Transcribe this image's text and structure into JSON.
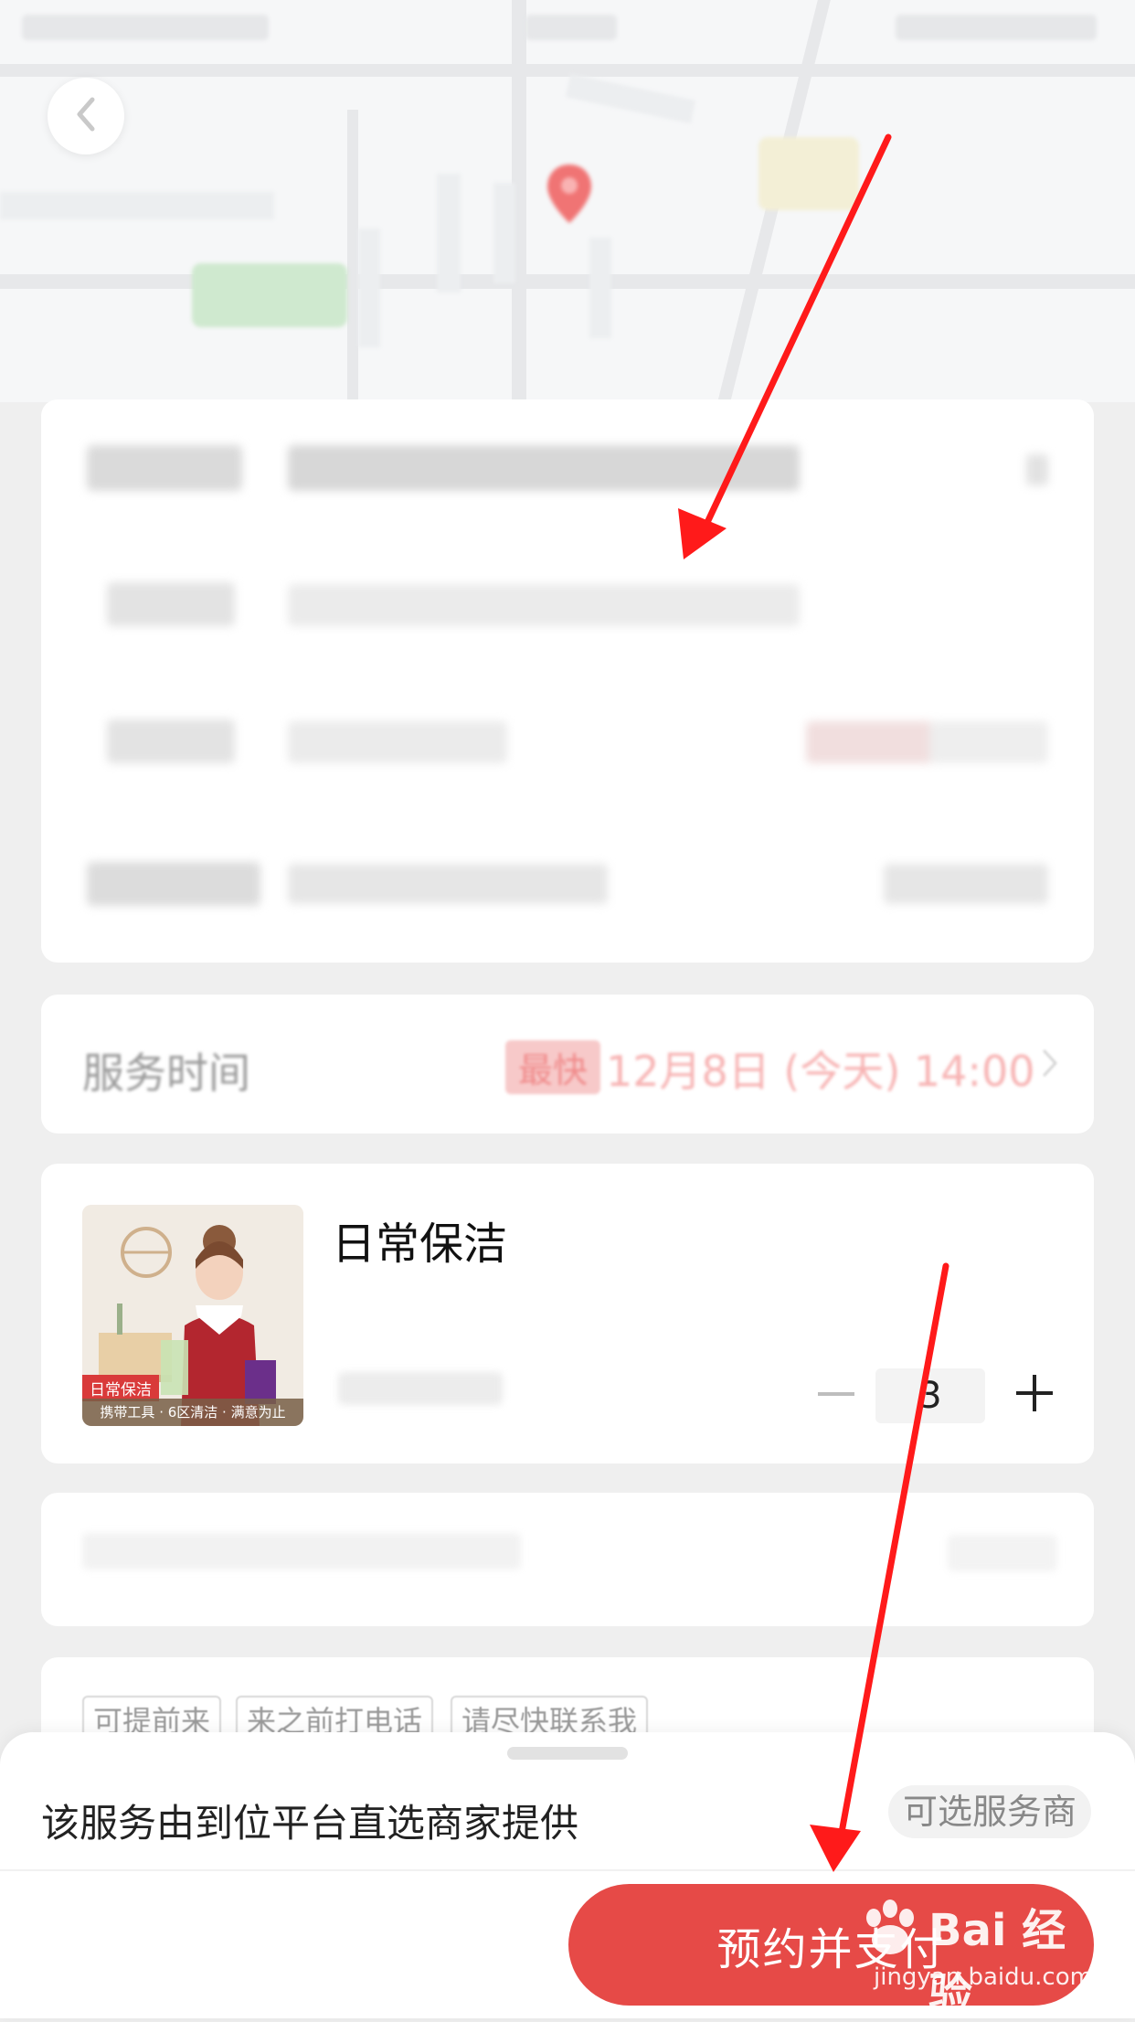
{
  "service_time": {
    "label": "服务时间",
    "badge": "最快",
    "value": "12月8日 (今天) 14:00"
  },
  "service_item": {
    "image": {
      "caption_tag": "日常保洁",
      "caption_desc": "携带工具 · 6区清洁 · 满意为止"
    },
    "title": "日常保洁",
    "quantity": "3"
  },
  "notes": {
    "tags": [
      "可提前来",
      "来之前打电话",
      "请尽快联系我"
    ]
  },
  "bottom_sheet": {
    "provider_text": "该服务由到位平台直选商家提供",
    "provider_option": "可选服务商",
    "pay_button": "预约并支付"
  },
  "watermark": {
    "text": "Bai 经验",
    "url": "jingyan.baidu.com"
  },
  "colors": {
    "accent": "#e64a47",
    "annotation_arrow": "#ff1a1a"
  },
  "icons": {
    "back": "chevron-left-icon",
    "pin": "map-pin-icon",
    "minus": "minus-icon",
    "plus": "plus-icon"
  }
}
